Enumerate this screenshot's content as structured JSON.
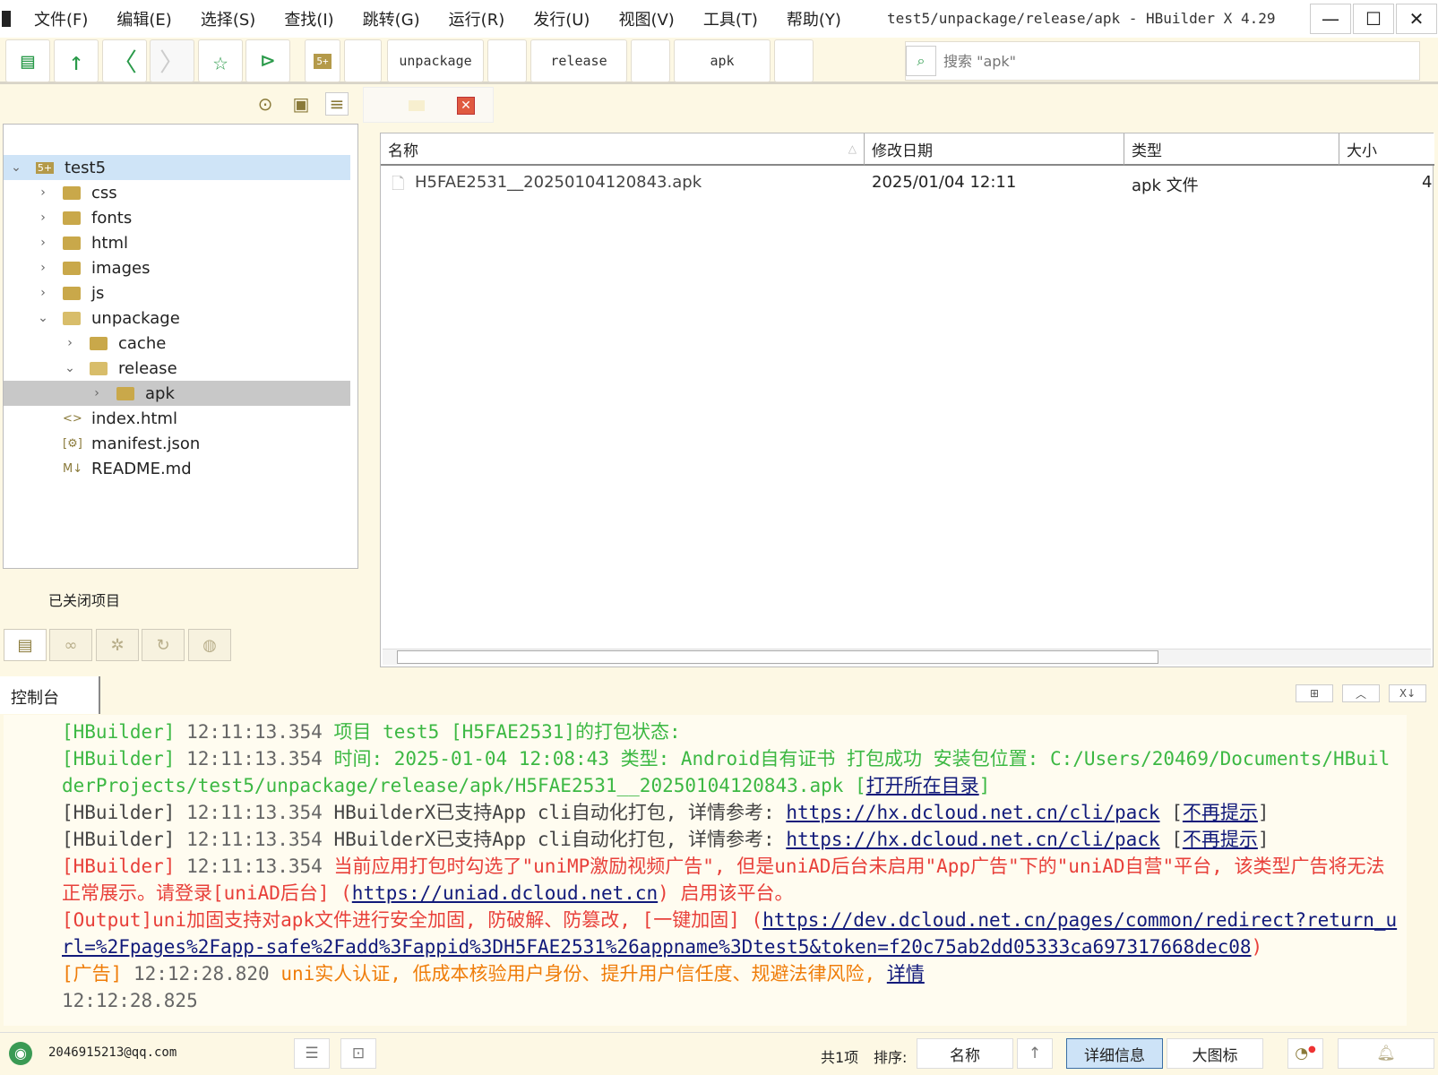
{
  "window": {
    "title": "test5/unpackage/release/apk - HBuilder X 4.29"
  },
  "menu": [
    "文件(F)",
    "编辑(E)",
    "选择(S)",
    "查找(I)",
    "跳转(G)",
    "运行(R)",
    "发行(U)",
    "视图(V)",
    "工具(T)",
    "帮助(Y)"
  ],
  "toolbar": {
    "breadcrumb": [
      "unpackage",
      "release",
      "apk"
    ],
    "search_placeholder": "搜索 \"apk\""
  },
  "tree": [
    {
      "label": "test5",
      "level": 0,
      "type": "project",
      "expanded": true,
      "selected": true
    },
    {
      "label": "css",
      "level": 1,
      "type": "folder"
    },
    {
      "label": "fonts",
      "level": 1,
      "type": "folder"
    },
    {
      "label": "html",
      "level": 1,
      "type": "folder"
    },
    {
      "label": "images",
      "level": 1,
      "type": "folder"
    },
    {
      "label": "js",
      "level": 1,
      "type": "folder"
    },
    {
      "label": "unpackage",
      "level": 1,
      "type": "folder",
      "expanded": true
    },
    {
      "label": "cache",
      "level": 2,
      "type": "folder"
    },
    {
      "label": "release",
      "level": 2,
      "type": "folder",
      "expanded": true
    },
    {
      "label": "apk",
      "level": 3,
      "type": "folder",
      "highlighted": true
    },
    {
      "label": "index.html",
      "level": 1,
      "type": "html"
    },
    {
      "label": "manifest.json",
      "level": 1,
      "type": "json"
    },
    {
      "label": "README.md",
      "level": 1,
      "type": "md"
    }
  ],
  "closed_projects_label": "已关闭项目",
  "filelist": {
    "columns": [
      "名称",
      "修改日期",
      "类型",
      "大小"
    ],
    "rows": [
      {
        "name": "H5FAE2531__20250104120843.apk",
        "date": "2025/01/04 12:11",
        "type": "apk 文件",
        "size": "4"
      }
    ]
  },
  "console": {
    "tab_label": "控制台",
    "lines": [
      [
        {
          "t": "[HBuilder] ",
          "c": "t-green"
        },
        {
          "t": "12:11:13.354 ",
          "c": "t-pre"
        },
        {
          "t": "项目 test5 [H5FAE2531]的打包状态:",
          "c": "t-green"
        }
      ],
      [
        {
          "t": "[HBuilder] ",
          "c": "t-green"
        },
        {
          "t": "12:11:13.354 ",
          "c": "t-pre"
        },
        {
          "t": "时间: 2025-01-04 12:08:43    类型: Android自有证书    打包成功    安装包位置: C:/Users/20469/Documents/HBuilderProjects/test5/unpackage/release/apk/H5FAE2531__20250104120843.apk  [",
          "c": "t-green"
        },
        {
          "t": "打开所在目录",
          "c": "t-link"
        },
        {
          "t": "]",
          "c": "t-green"
        }
      ],
      [
        {
          "t": "[HBuilder] ",
          "c": "t-dark"
        },
        {
          "t": "12:11:13.354 ",
          "c": "t-pre"
        },
        {
          "t": "HBuilderX已支持App cli自动化打包, 详情参考: ",
          "c": "t-dark"
        },
        {
          "t": "https://hx.dcloud.net.cn/cli/pack",
          "c": "t-link"
        },
        {
          "t": " [",
          "c": "t-dark"
        },
        {
          "t": "不再提示",
          "c": "t-link"
        },
        {
          "t": "]",
          "c": "t-dark"
        }
      ],
      [
        {
          "t": "[HBuilder] ",
          "c": "t-dark"
        },
        {
          "t": "12:11:13.354 ",
          "c": "t-pre"
        },
        {
          "t": "HBuilderX已支持App cli自动化打包, 详情参考: ",
          "c": "t-dark"
        },
        {
          "t": "https://hx.dcloud.net.cn/cli/pack",
          "c": "t-link"
        },
        {
          "t": " [",
          "c": "t-dark"
        },
        {
          "t": "不再提示",
          "c": "t-link"
        },
        {
          "t": "]",
          "c": "t-dark"
        }
      ],
      [
        {
          "t": "[HBuilder] ",
          "c": "t-red"
        },
        {
          "t": "12:11:13.354 ",
          "c": "t-pre"
        },
        {
          "t": "当前应用打包时勾选了\"uniMP激励视频广告\", 但是uniAD后台未启用\"App广告\"下的\"uniAD自营\"平台, 该类型广告将无法正常展示。请登录[uniAD后台] (",
          "c": "t-red"
        },
        {
          "t": "https://uniad.dcloud.net.cn",
          "c": "t-link"
        },
        {
          "t": ") 启用该平台。",
          "c": "t-red"
        }
      ],
      [
        {
          "t": "[Output]uni加固支持对apk文件进行安全加固, 防破解、防篡改, [一键加固] (",
          "c": "t-red"
        },
        {
          "t": "https://dev.dcloud.net.cn/pages/common/redirect?return_url=%2Fpages%2Fapp-safe%2Fadd%3Fappid%3DH5FAE2531%26appname%3Dtest5&token=f20c75ab2dd05333ca697317668dec08",
          "c": "t-link"
        },
        {
          "t": ")",
          "c": "t-red"
        }
      ],
      [
        {
          "t": "[广告] ",
          "c": "t-orange"
        },
        {
          "t": "12:12:28.820 ",
          "c": "t-pre"
        },
        {
          "t": "uni实人认证, 低成本核验用户身份、提升用户信任度、规避法律风险, ",
          "c": "t-orange"
        },
        {
          "t": "详情",
          "c": "t-link"
        }
      ],
      [
        {
          "t": "12:12:28.825",
          "c": "t-pre"
        }
      ]
    ]
  },
  "statusbar": {
    "user": "2046915213@qq.com",
    "count": "共1项",
    "sort_label": "排序:",
    "sort_value": "名称",
    "view_detail": "详细信息",
    "view_large": "大图标"
  },
  "colors": {
    "background": "#fdf8e4",
    "accent_green": "#3cb843",
    "error_red": "#e8403a",
    "ad_orange": "#ef7d0a",
    "selected_blue": "#cfe4f7"
  }
}
